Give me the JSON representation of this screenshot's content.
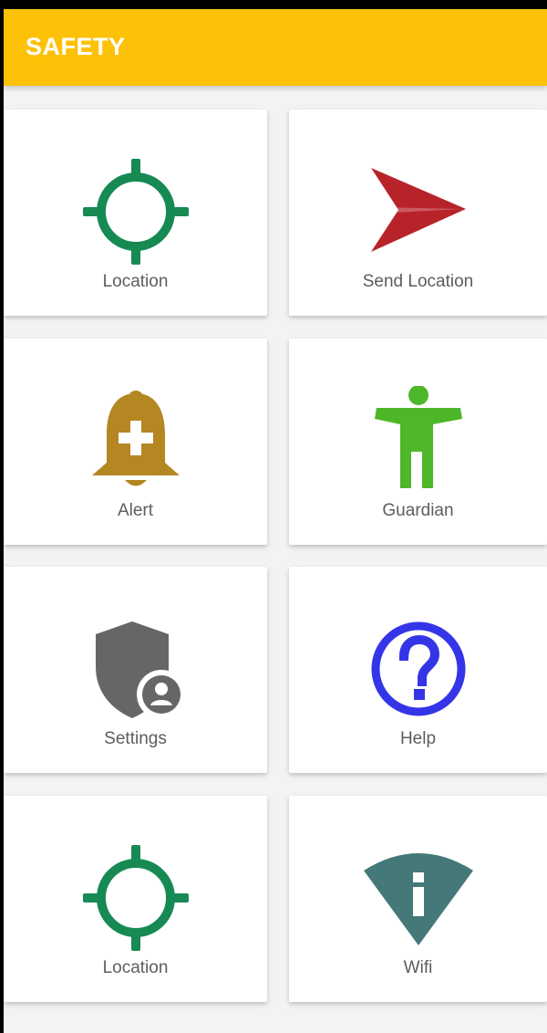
{
  "app_bar": {
    "title": "SAFETY",
    "color": "#fdc107"
  },
  "tiles": [
    {
      "label": "Location",
      "icon": "crosshair-icon",
      "color": "#178a53"
    },
    {
      "label": "Send Location",
      "icon": "send-icon",
      "color": "#b8232a"
    },
    {
      "label": "Alert",
      "icon": "alarm-bell-plus-icon",
      "color": "#b58722"
    },
    {
      "label": "Guardian",
      "icon": "person-icon",
      "color": "#4db729"
    },
    {
      "label": "Settings",
      "icon": "shield-account-icon",
      "color": "#666666"
    },
    {
      "label": "Help",
      "icon": "help-circle-icon",
      "color": "#3535e8"
    },
    {
      "label": "Location",
      "icon": "crosshair-icon",
      "color": "#178a53"
    },
    {
      "label": "Wifi",
      "icon": "wifi-info-icon",
      "color": "#457879"
    }
  ]
}
